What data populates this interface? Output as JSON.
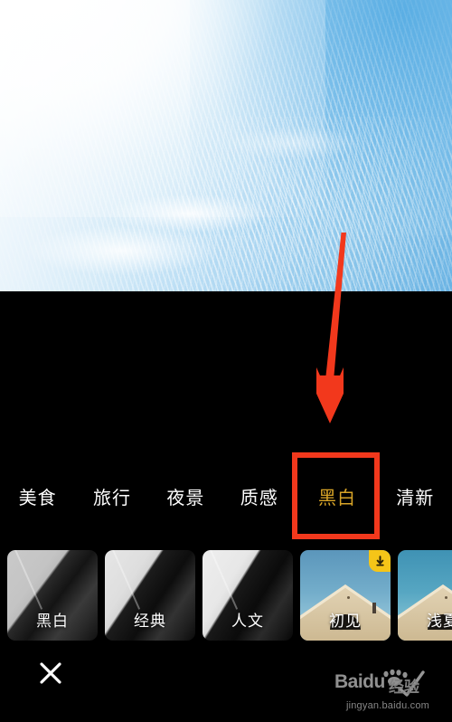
{
  "app": {
    "screen_name": "photo-filter-picker",
    "background_color": "#000000"
  },
  "preview": {
    "name": "sky-photo-preview",
    "description": "blue sky with rippled cirrocumulus clouds",
    "sky_blue": "#68b2e3",
    "cloud_white": "#ffffff"
  },
  "annotation": {
    "arrow_color": "#f2381c",
    "box_color": "#f2381c",
    "arrow_name": "red-pointer-arrow",
    "box_target": "黑白"
  },
  "categories": {
    "items": [
      {
        "label": "美食",
        "active": false
      },
      {
        "label": "旅行",
        "active": false
      },
      {
        "label": "夜景",
        "active": false
      },
      {
        "label": "质感",
        "active": false
      },
      {
        "label": "黑白",
        "active": true
      },
      {
        "label": "清新",
        "active": false
      }
    ],
    "active_color": "#d8a427",
    "inactive_color": "#ffffff"
  },
  "filters": {
    "items": [
      {
        "label": "黑白",
        "style": "gray",
        "variant": "v1",
        "badge": false
      },
      {
        "label": "经典",
        "style": "gray",
        "variant": "v2",
        "badge": false
      },
      {
        "label": "人文",
        "style": "gray",
        "variant": "v3",
        "badge": false
      },
      {
        "label": "初见",
        "style": "house",
        "variant": "warm",
        "badge": true,
        "badge_icon": "download-icon"
      },
      {
        "label": "浅夏",
        "style": "house",
        "variant": "cool",
        "badge": false
      }
    ]
  },
  "bottom_bar": {
    "close_label": "×",
    "close_icon": "close-x-icon"
  },
  "watermark": {
    "brand_latin": "Baidu",
    "brand_cn": "经验",
    "url": "jingyan.baidu.com",
    "overlay_icon": "checkmark-icon"
  }
}
